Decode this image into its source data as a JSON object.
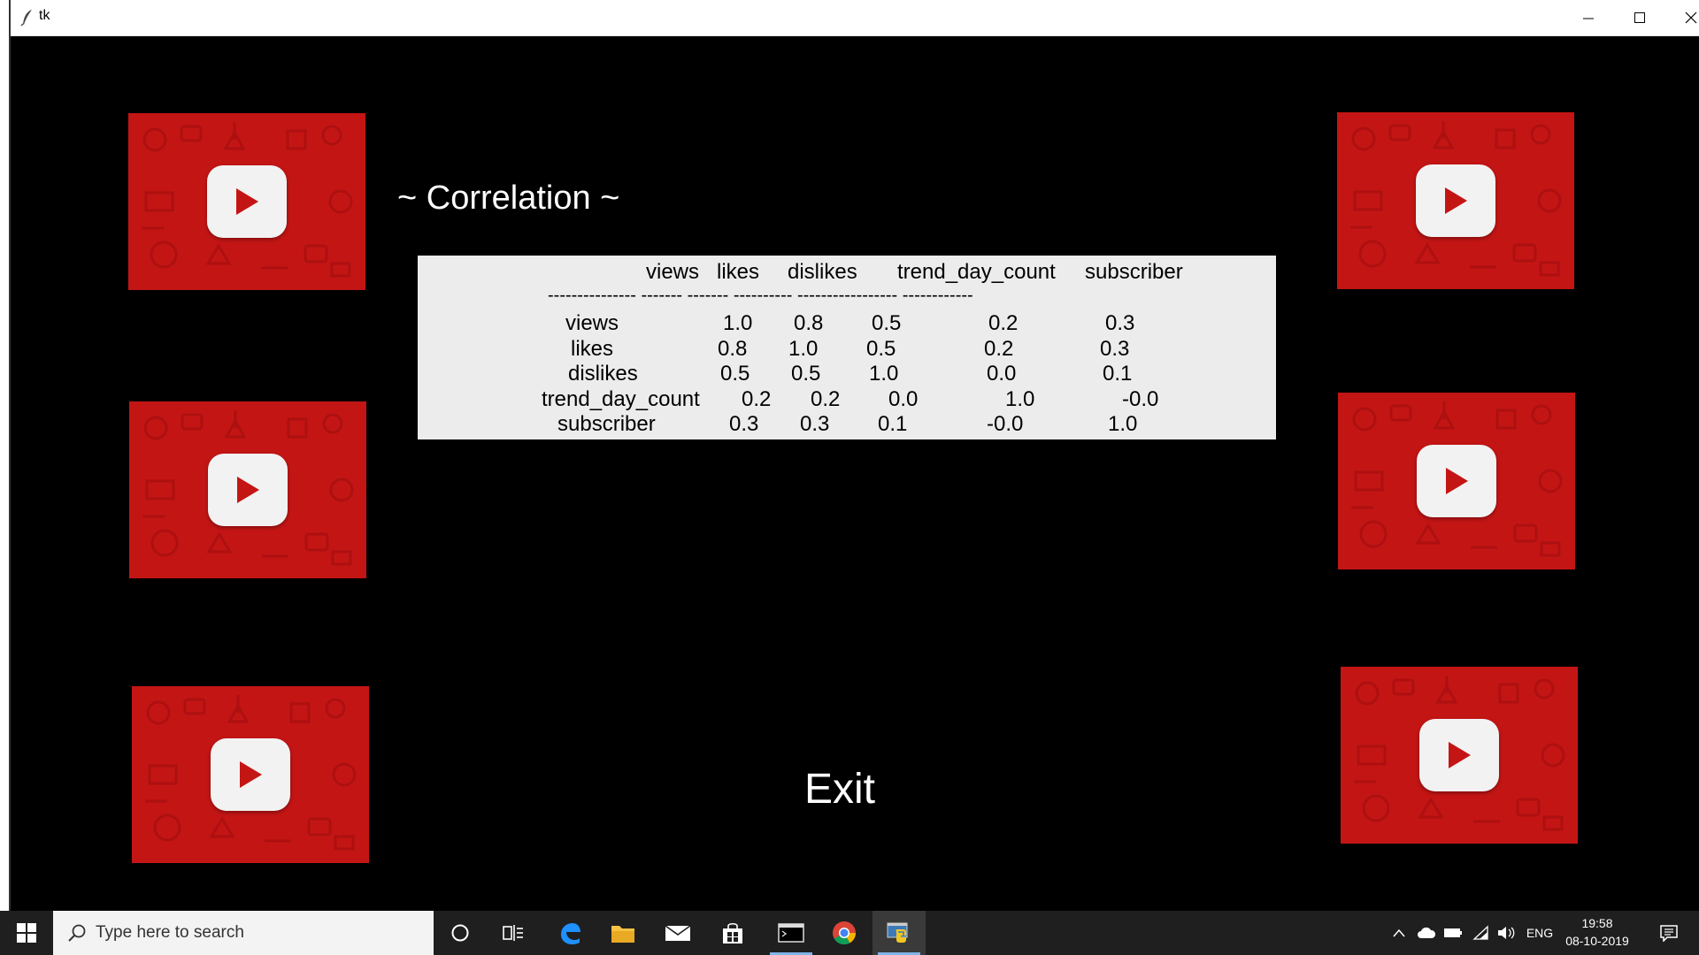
{
  "window": {
    "title": "tk"
  },
  "app": {
    "heading": "~ Correlation ~",
    "exit_label": "Exit",
    "table": {
      "columns": [
        "views",
        "likes",
        "dislikes",
        "trend_day_count",
        "subscriber"
      ],
      "separator": "---------------   -------   -------   ----------   -----------------   ------------",
      "rows": [
        {
          "label": "views",
          "values": [
            "1.0",
            "0.8",
            "0.5",
            "0.2",
            "0.3"
          ]
        },
        {
          "label": "likes",
          "values": [
            "0.8",
            "1.0",
            "0.5",
            "0.2",
            "0.3"
          ]
        },
        {
          "label": "dislikes",
          "values": [
            "0.5",
            "0.5",
            "1.0",
            "0.0",
            "0.1"
          ]
        },
        {
          "label": "trend_day_count",
          "values": [
            "0.2",
            "0.2",
            "0.0",
            "1.0",
            "-0.0"
          ]
        },
        {
          "label": "subscriber",
          "values": [
            "0.3",
            "0.3",
            "0.1",
            "-0.0",
            "1.0"
          ]
        }
      ]
    }
  },
  "taskbar": {
    "search_placeholder": "Type here to search",
    "language": "ENG",
    "time": "19:58",
    "date": "08-10-2019"
  },
  "colors": {
    "app_background": "#000000",
    "tile_red": "#c41515",
    "table_background": "#ececec",
    "taskbar": "#1f1f1f"
  }
}
